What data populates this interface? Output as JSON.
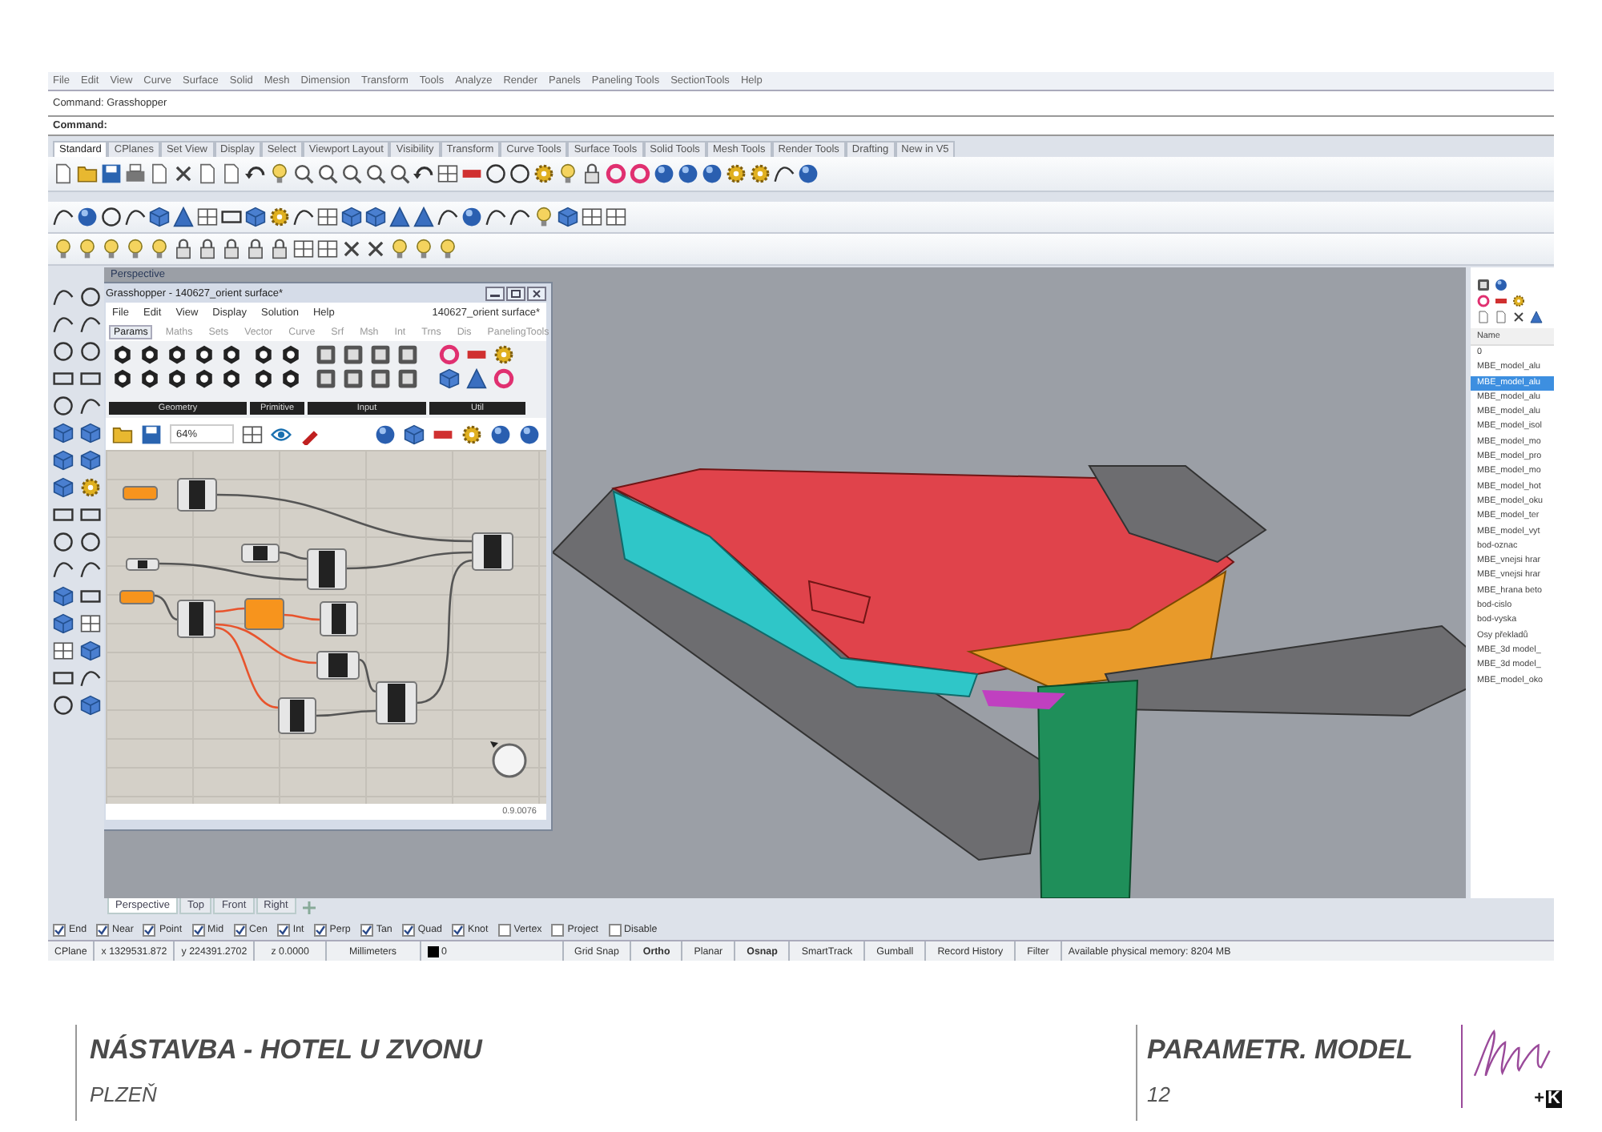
{
  "menu": [
    "File",
    "Edit",
    "View",
    "Curve",
    "Surface",
    "Solid",
    "Mesh",
    "Dimension",
    "Transform",
    "Tools",
    "Analyze",
    "Render",
    "Panels",
    "Paneling Tools",
    "SectionTools",
    "Help"
  ],
  "command_history": "Command: Grasshopper",
  "command_prompt": "Command:",
  "toolbar_tabs": [
    {
      "label": "Standard",
      "selected": true
    },
    {
      "label": "CPlanes",
      "selected": false
    },
    {
      "label": "Set View",
      "selected": false
    },
    {
      "label": "Display",
      "selected": false
    },
    {
      "label": "Select",
      "selected": false
    },
    {
      "label": "Viewport Layout",
      "selected": false
    },
    {
      "label": "Visibility",
      "selected": false
    },
    {
      "label": "Transform",
      "selected": false
    },
    {
      "label": "Curve Tools",
      "selected": false
    },
    {
      "label": "Surface Tools",
      "selected": false
    },
    {
      "label": "Solid Tools",
      "selected": false
    },
    {
      "label": "Mesh Tools",
      "selected": false
    },
    {
      "label": "Render Tools",
      "selected": false
    },
    {
      "label": "Drafting",
      "selected": false
    },
    {
      "label": "New in V5",
      "selected": false
    }
  ],
  "viewport": {
    "label": "Perspective"
  },
  "grasshopper": {
    "title": "Grasshopper - 140627_orient surface*",
    "menu": [
      "File",
      "Edit",
      "View",
      "Display",
      "Solution",
      "Help"
    ],
    "file_name": "140627_orient surface*",
    "tabs": [
      {
        "label": "Params",
        "selected": true
      },
      {
        "label": "Maths",
        "selected": false
      },
      {
        "label": "Sets",
        "selected": false
      },
      {
        "label": "Vector",
        "selected": false
      },
      {
        "label": "Curve",
        "selected": false
      },
      {
        "label": "Srf",
        "selected": false
      },
      {
        "label": "Msh",
        "selected": false
      },
      {
        "label": "Int",
        "selected": false
      },
      {
        "label": "Trns",
        "selected": false
      },
      {
        "label": "Dis",
        "selected": false
      },
      {
        "label": "PanelingTools",
        "selected": false
      }
    ],
    "panels": [
      {
        "label": "Geometry"
      },
      {
        "label": "Primitive"
      },
      {
        "label": "Input"
      },
      {
        "label": "Util"
      }
    ],
    "zoom": "64%",
    "version": "0.9.0076"
  },
  "layers": {
    "header": "Name",
    "items": [
      {
        "name": "0",
        "selected": false
      },
      {
        "name": "MBE_model_alu",
        "selected": false
      },
      {
        "name": "MBE_model_alu",
        "selected": true
      },
      {
        "name": "MBE_model_alu",
        "selected": false
      },
      {
        "name": "MBE_model_alu",
        "selected": false
      },
      {
        "name": "MBE_model_isol",
        "selected": false
      },
      {
        "name": "MBE_model_mo",
        "selected": false
      },
      {
        "name": "MBE_model_pro",
        "selected": false
      },
      {
        "name": "MBE_model_mo",
        "selected": false
      },
      {
        "name": "MBE_model_hot",
        "selected": false
      },
      {
        "name": "MBE_model_oku",
        "selected": false
      },
      {
        "name": "MBE_model_ter",
        "selected": false
      },
      {
        "name": "MBE_model_vyt",
        "selected": false
      },
      {
        "name": "bod-oznac",
        "selected": false
      },
      {
        "name": "MBE_vnejsi hrar",
        "selected": false
      },
      {
        "name": "MBE_vnejsi hrar",
        "selected": false
      },
      {
        "name": "MBE_hrana beto",
        "selected": false
      },
      {
        "name": "bod-cislo",
        "selected": false
      },
      {
        "name": "bod-vyska",
        "selected": false
      },
      {
        "name": "Osy překladů",
        "selected": false
      },
      {
        "name": "MBE_3d model_",
        "selected": false
      },
      {
        "name": "MBE_3d model_",
        "selected": false
      },
      {
        "name": "MBE_model_oko",
        "selected": false
      }
    ]
  },
  "viewport_tabs": [
    {
      "label": "Perspective",
      "selected": true
    },
    {
      "label": "Top",
      "selected": false
    },
    {
      "label": "Front",
      "selected": false
    },
    {
      "label": "Right",
      "selected": false
    }
  ],
  "osnaps": [
    {
      "label": "End",
      "checked": true
    },
    {
      "label": "Near",
      "checked": true
    },
    {
      "label": "Point",
      "checked": true
    },
    {
      "label": "Mid",
      "checked": true
    },
    {
      "label": "Cen",
      "checked": true
    },
    {
      "label": "Int",
      "checked": true
    },
    {
      "label": "Perp",
      "checked": true
    },
    {
      "label": "Tan",
      "checked": true
    },
    {
      "label": "Quad",
      "checked": true
    },
    {
      "label": "Knot",
      "checked": true
    },
    {
      "label": "Vertex",
      "checked": false
    },
    {
      "label": "Project",
      "checked": false
    },
    {
      "label": "Disable",
      "checked": false
    }
  ],
  "status_bar": {
    "cplane": "CPlane",
    "x": "x 1329531.872",
    "y": "y 224391.2702",
    "z": "z 0.0000",
    "units": "Millimeters",
    "layer": "0",
    "toggles": [
      {
        "label": "Grid Snap",
        "on": false
      },
      {
        "label": "Ortho",
        "on": true
      },
      {
        "label": "Planar",
        "on": false
      },
      {
        "label": "Osnap",
        "on": true
      },
      {
        "label": "SmartTrack",
        "on": false
      },
      {
        "label": "Gumball",
        "on": false
      },
      {
        "label": "Record History",
        "on": false
      },
      {
        "label": "Filter",
        "on": false
      }
    ],
    "memory": "Available physical memory: 8204 MB"
  },
  "footer": {
    "title": "NÁSTAVBA - HOTEL U ZVONU",
    "subtitle": "PLZEŇ",
    "section": "PARAMETR. MODEL",
    "page": "12",
    "logo_plus": "+",
    "logo_letter": "K"
  }
}
